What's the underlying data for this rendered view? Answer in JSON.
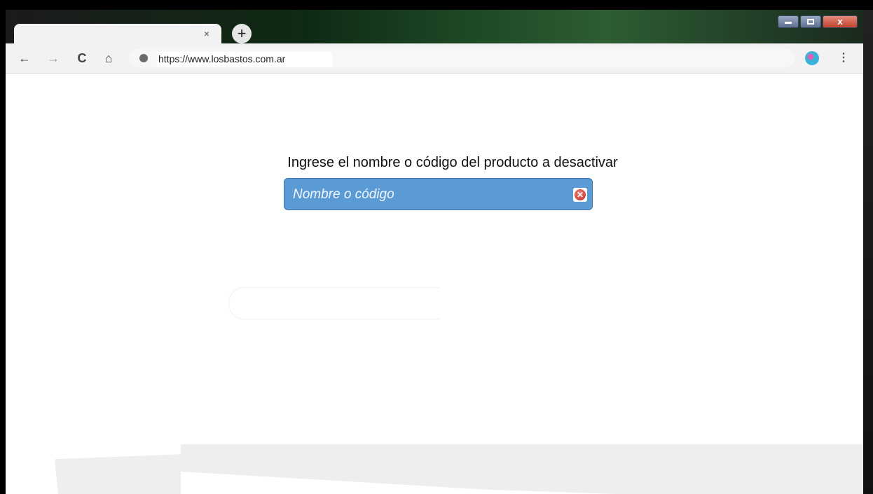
{
  "browser": {
    "tab_close_glyph": "×",
    "new_tab_glyph": "+",
    "url": "https://www.losbastos.com.ar",
    "menu_glyph": "⋮",
    "back_glyph": "←",
    "forward_glyph": "→",
    "reload_glyph": "C",
    "home_glyph": "⌂"
  },
  "window_controls": {
    "close_glyph": "x"
  },
  "page": {
    "prompt": "Ingrese el nombre o código del producto a desactivar",
    "search": {
      "placeholder": "Nombre o código",
      "value": ""
    },
    "clear_glyph": "✕"
  },
  "colors": {
    "accent": "#5b9bd5",
    "clear": "#d93a31"
  }
}
